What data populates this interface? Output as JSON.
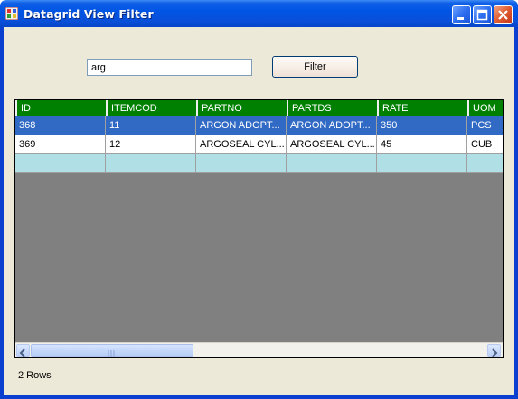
{
  "window": {
    "title": "Datagrid View Filter"
  },
  "search": {
    "value": "arg"
  },
  "filter_button": {
    "label": "Filter"
  },
  "grid": {
    "columns": [
      "ID",
      "ITEMCOD",
      "PARTNO",
      "PARTDS",
      "RATE",
      "UOM"
    ],
    "rows": [
      [
        "368",
        "11",
        "ARGON ADOPT...",
        "ARGON ADOPT...",
        "350",
        "PCS"
      ],
      [
        "369",
        "12",
        "ARGOSEAL CYL...",
        "ARGOSEAL CYL...",
        "45",
        "CUB"
      ]
    ],
    "header_color": "#008000",
    "selected_color": "#316ac5",
    "new_row_color": "#b0e0e6",
    "background_color": "#808080"
  },
  "status": {
    "row_count": "2 Rows"
  }
}
